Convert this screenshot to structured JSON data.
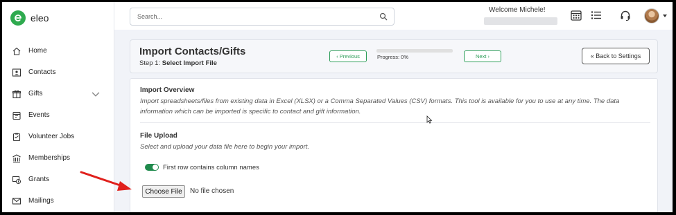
{
  "app": {
    "brand": "eleo",
    "brand_color": "#2faa4f",
    "accent": "#2e9e5a"
  },
  "sidebar": {
    "items": [
      {
        "label": "Home",
        "icon": "home-icon"
      },
      {
        "label": "Contacts",
        "icon": "contacts-icon"
      },
      {
        "label": "Gifts",
        "icon": "gift-icon",
        "expandable": true
      },
      {
        "label": "Events",
        "icon": "calendar-icon"
      },
      {
        "label": "Volunteer Jobs",
        "icon": "clipboard-icon"
      },
      {
        "label": "Memberships",
        "icon": "building-icon"
      },
      {
        "label": "Grants",
        "icon": "grant-icon"
      },
      {
        "label": "Mailings",
        "icon": "mail-icon"
      }
    ]
  },
  "topbar": {
    "search_placeholder": "Search...",
    "welcome": "Welcome Michele!",
    "icons": [
      "calendar-grid-icon",
      "list-icon",
      "headset-icon",
      "avatar"
    ]
  },
  "header": {
    "title": "Import Contacts/Gifts",
    "step_prefix": "Step 1: ",
    "step_name": "Select Import File",
    "previous_label": "‹ Previous",
    "next_label": "Next ›",
    "progress_label": "Progress: 0%",
    "progress_value": 0,
    "back_label": "« Back to Settings"
  },
  "overview": {
    "title": "Import Overview",
    "text": "Import spreadsheets/files from existing data in Excel (XLSX) or a Comma Separated Values (CSV) formats. This tool is available for you to use at any time. The data information which can be imported is specific to contact and gift information."
  },
  "upload": {
    "title": "File Upload",
    "text": "Select and upload your data file here to begin your import.",
    "toggle_label": "First row contains column names",
    "toggle_on": true,
    "choose_label": "Choose File",
    "status": "No file chosen"
  }
}
